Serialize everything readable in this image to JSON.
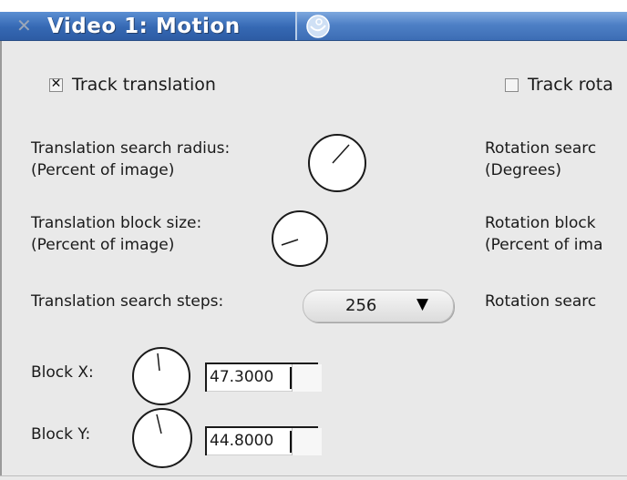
{
  "window": {
    "title": "Video 1: Motion"
  },
  "track_translation": {
    "label": "Track translation",
    "checked": true
  },
  "track_rotation": {
    "label": "Track rota",
    "checked": false
  },
  "translation": {
    "search_radius_label": "Translation search radius:",
    "block_size_label": "Translation block size:",
    "percent_label": "(Percent of image)",
    "search_steps_label": "Translation search steps:",
    "search_steps_value": "256"
  },
  "rotation": {
    "search_label": "Rotation searc",
    "degrees_label": "(Degrees)",
    "block_label": "Rotation block",
    "percent_label": "(Percent of ima",
    "steps_label": "Rotation searc"
  },
  "block_x": {
    "label": "Block X:",
    "value": "47.3000"
  },
  "block_y": {
    "label": "Block Y:",
    "value": "44.8000"
  }
}
